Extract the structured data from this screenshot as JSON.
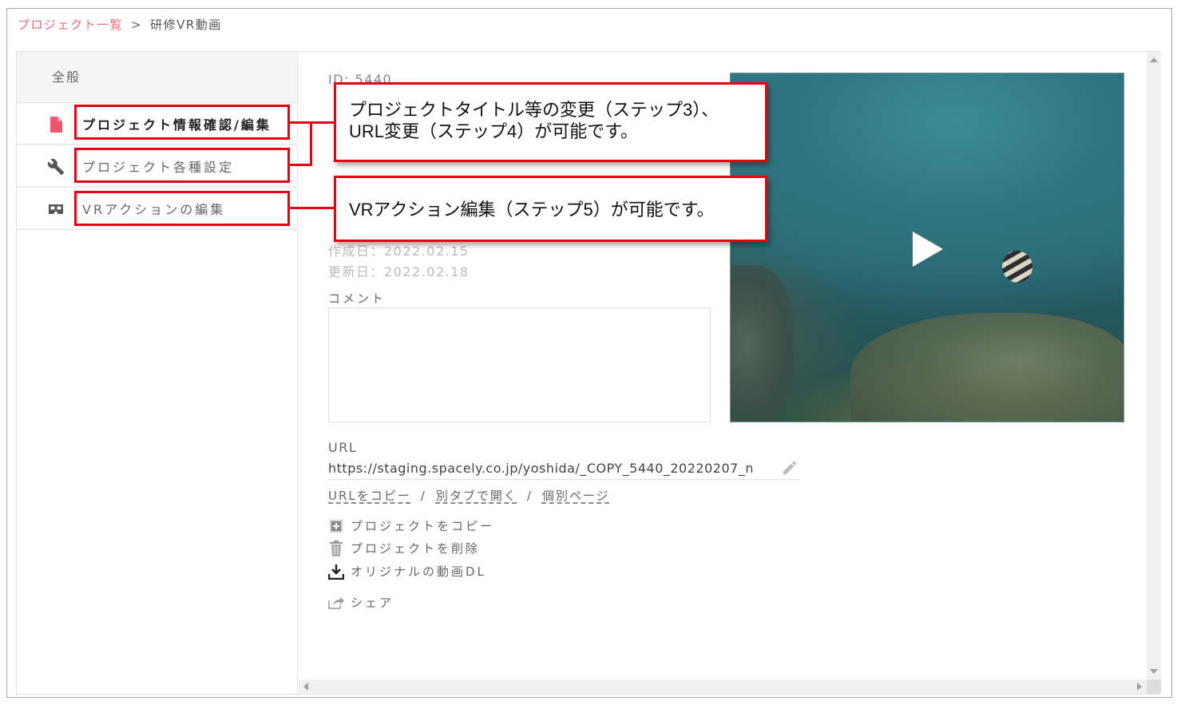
{
  "breadcrumb": {
    "link": "プロジェクト一覧",
    "separator": ">",
    "current": "研修VR動画"
  },
  "sidebar": {
    "header": "全般",
    "items": [
      {
        "label": "プロジェクト情報確認/編集",
        "icon": "document-icon",
        "active": true
      },
      {
        "label": "プロジェクト各種設定",
        "icon": "wrench-icon",
        "active": false
      },
      {
        "label": "VRアクションの編集",
        "icon": "vr-goggles-icon",
        "active": false
      }
    ]
  },
  "details": {
    "id": "ID: 5440",
    "created": "作成日：2022.02.15",
    "updated": "更新日：2022.02.18",
    "comment_label": "コメント",
    "comment_value": ""
  },
  "url": {
    "label": "URL",
    "value": "https://staging.spacely.co.jp/yoshida/_COPY_5440_20220207_n",
    "actions": [
      "URLをコピー",
      "別タブで開く",
      "個別ページ"
    ],
    "separator": "/"
  },
  "actions": [
    {
      "label": "プロジェクトをコピー",
      "icon": "copy-icon"
    },
    {
      "label": "プロジェクトを削除",
      "icon": "trash-icon"
    },
    {
      "label": "オリジナルの動画DL",
      "icon": "download-icon"
    },
    {
      "label": "シェア",
      "icon": "share-icon"
    }
  ],
  "video": {
    "icon": "play-icon"
  },
  "callouts": [
    {
      "text_line1": "プロジェクトタイトル等の変更（ステップ3）、",
      "text_line2": "URL変更（ステップ4）が可能です。"
    },
    {
      "text_line1": "VRアクション編集（ステップ5）が可能です。"
    }
  ],
  "colors": {
    "link": "#f06a7a",
    "highlight": "#e60012",
    "active_icon": "#f0566a"
  }
}
